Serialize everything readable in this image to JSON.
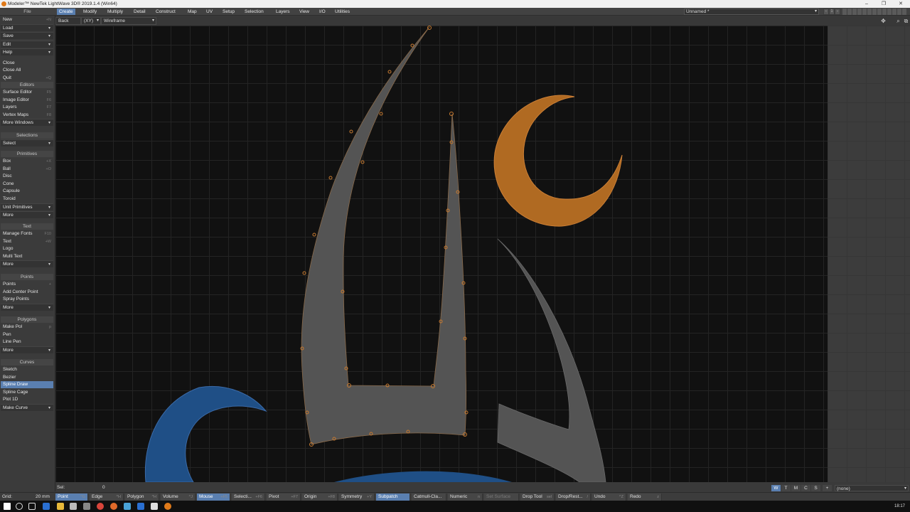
{
  "window": {
    "title": "Modeler™ NewTek LightWave 3D® 2019.1.4 (Win64)",
    "minimize": "–",
    "maximize": "❐",
    "close": "✕"
  },
  "menubar": {
    "file_label": "File",
    "tabs": [
      "Create",
      "Modify",
      "Multiply",
      "Detail",
      "Construct",
      "Map",
      "UV",
      "Setup",
      "Selection",
      "Layers",
      "View",
      "I/O",
      "Utilities"
    ],
    "active_tab": "Create",
    "scene": "Unnamed *",
    "layer_number": "1"
  },
  "viewport_header": {
    "view": "Back",
    "axis": "(XY)",
    "mode": "Wireframe"
  },
  "sidebar": {
    "file_items": [
      {
        "label": "New",
        "shortcut": "+N"
      },
      {
        "label": "Load",
        "dropdown": true
      },
      {
        "label": "Save",
        "dropdown": true
      },
      {
        "label": "Edit",
        "dropdown": true
      },
      {
        "label": "Help",
        "dropdown": true
      },
      {
        "label": "Close"
      },
      {
        "label": "Close All"
      },
      {
        "label": "Quit",
        "shortcut": "+Q"
      }
    ],
    "editors_head": "Editors",
    "editors": [
      {
        "label": "Surface Editor",
        "shortcut": "F5"
      },
      {
        "label": "Image Editor",
        "shortcut": "F6"
      },
      {
        "label": "Layers",
        "shortcut": "F7"
      },
      {
        "label": "Vertex Maps",
        "shortcut": "F8"
      },
      {
        "label": "More Windows",
        "dropdown": true
      }
    ],
    "selections_head": "Selections",
    "selections": [
      {
        "label": "Select",
        "dropdown": true
      }
    ],
    "primitives_head": "Primitives",
    "primitives": [
      {
        "label": "Box",
        "shortcut": "+X"
      },
      {
        "label": "Ball",
        "shortcut": "+O"
      },
      {
        "label": "Disc"
      },
      {
        "label": "Cone"
      },
      {
        "label": "Capsule"
      },
      {
        "label": "Toroid"
      },
      {
        "label": "Unit Primitives",
        "dropdown": true
      },
      {
        "label": "More",
        "dropdown": true
      }
    ],
    "text_head": "Text",
    "text": [
      {
        "label": "Manage Fonts",
        "shortcut": "F10"
      },
      {
        "label": "Text",
        "shortcut": "+W"
      },
      {
        "label": "Logo"
      },
      {
        "label": "Multi Text"
      },
      {
        "label": "More",
        "dropdown": true
      }
    ],
    "points_head": "Points",
    "points": [
      {
        "label": "Points",
        "shortcut": "+"
      },
      {
        "label": "Add Center Point"
      },
      {
        "label": "Spray Points"
      },
      {
        "label": "More",
        "dropdown": true
      }
    ],
    "polygons_head": "Polygons",
    "polygons": [
      {
        "label": "Make Pol",
        "shortcut": "p"
      },
      {
        "label": "Pen"
      },
      {
        "label": "Line Pen"
      },
      {
        "label": "More",
        "dropdown": true
      }
    ],
    "curves_head": "Curves",
    "curves": [
      {
        "label": "Sketch"
      },
      {
        "label": "Bezier"
      },
      {
        "label": "Spline Draw",
        "selected": true
      },
      {
        "label": "Spline Cage"
      },
      {
        "label": "Plot 1D"
      },
      {
        "label": "Make Curve",
        "dropdown": true
      }
    ]
  },
  "status": {
    "sel_label": "Sel:",
    "sel_value": "0"
  },
  "wtmc": [
    "W",
    "T",
    "M",
    "C",
    "S",
    "+"
  ],
  "wtmc_active": "W",
  "none_value": "(none)",
  "bottom": {
    "grid_label": "Grid:",
    "grid_value": "20 mm",
    "buttons": [
      {
        "label": "Point",
        "shortcut": "^G",
        "on": true
      },
      {
        "label": "Edge",
        "shortcut": "^H"
      },
      {
        "label": "Polygon",
        "shortcut": "^H"
      },
      {
        "label": "Volume",
        "shortcut": "^J"
      },
      {
        "label": "Mouse",
        "shortcut": "+F5",
        "on": true
      },
      {
        "label": "Selecti...",
        "shortcut": "+F6"
      },
      {
        "label": "Pivot",
        "shortcut": "+F7"
      },
      {
        "label": "Origin",
        "shortcut": "+F8"
      },
      {
        "label": "Symmetry",
        "shortcut": "+Y"
      },
      {
        "label": "Subpatch",
        "on": true
      },
      {
        "label": "Catmull-Cla...",
        "shortcut": ""
      },
      {
        "label": "Numeric",
        "shortcut": "n"
      },
      {
        "label": "Set Surface",
        "dim": true
      },
      {
        "label": "Drop Tool",
        "shortcut": "sel"
      },
      {
        "label": "Drop/Rest...",
        "shortcut": "/"
      },
      {
        "label": "Undo",
        "shortcut": "^Z"
      },
      {
        "label": "Redo",
        "shortcut": "z"
      }
    ]
  },
  "taskbar": {
    "time": "18:17"
  },
  "colors": {
    "accent": "#5a7fb0",
    "orange": "#b06a22",
    "blue": "#1f4f86",
    "grey_shape": "#545454",
    "point": "#c77a30"
  }
}
